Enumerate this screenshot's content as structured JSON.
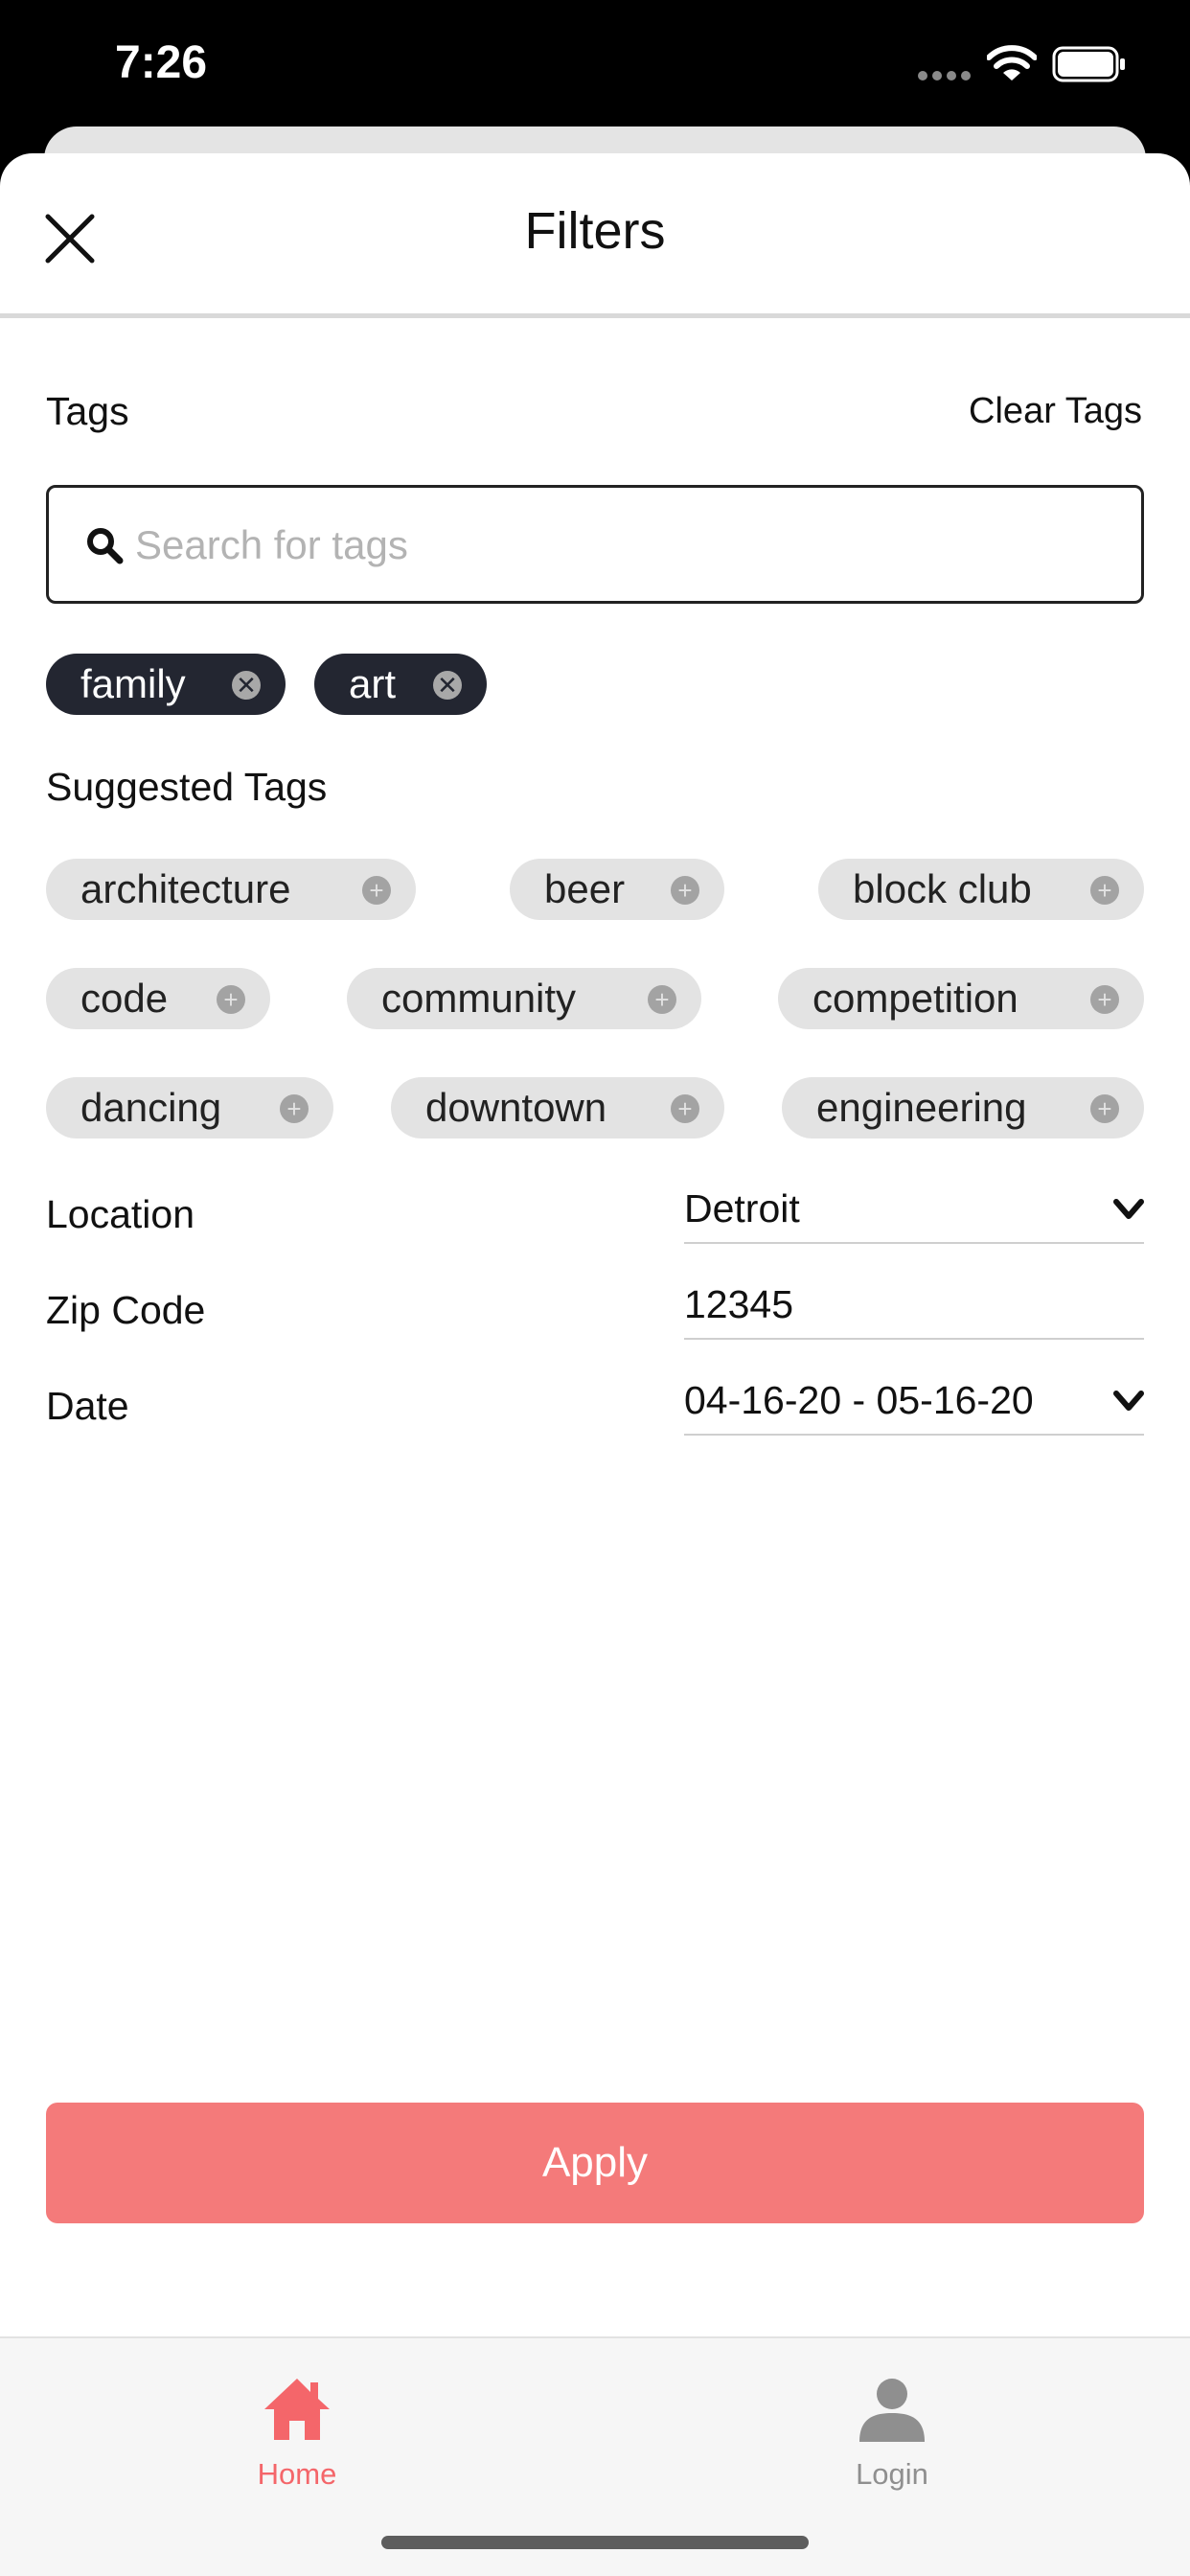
{
  "status_bar": {
    "time": "7:26"
  },
  "header": {
    "title": "Filters"
  },
  "tags": {
    "label": "Tags",
    "clear_label": "Clear Tags",
    "search_placeholder": "Search for tags",
    "search_value": ""
  },
  "selected_tags": [
    {
      "label": "family"
    },
    {
      "label": "art"
    }
  ],
  "suggested": {
    "label": "Suggested Tags",
    "items": [
      {
        "label": "architecture"
      },
      {
        "label": "beer"
      },
      {
        "label": "block club"
      },
      {
        "label": "code"
      },
      {
        "label": "community"
      },
      {
        "label": "competition"
      },
      {
        "label": "dancing"
      },
      {
        "label": "downtown"
      },
      {
        "label": "engineering"
      }
    ]
  },
  "location": {
    "label": "Location",
    "value": "Detroit"
  },
  "zip": {
    "label": "Zip Code",
    "value": "12345"
  },
  "date": {
    "label": "Date",
    "value": "04-16-20 - 05-16-20"
  },
  "apply_label": "Apply",
  "tab_bar": {
    "home_label": "Home",
    "login_label": "Login"
  },
  "colors": {
    "accent": "#f47a7a",
    "tab_active": "#f4666a",
    "chip_selected": "#232631",
    "chip_suggested": "#e3e3e3"
  }
}
